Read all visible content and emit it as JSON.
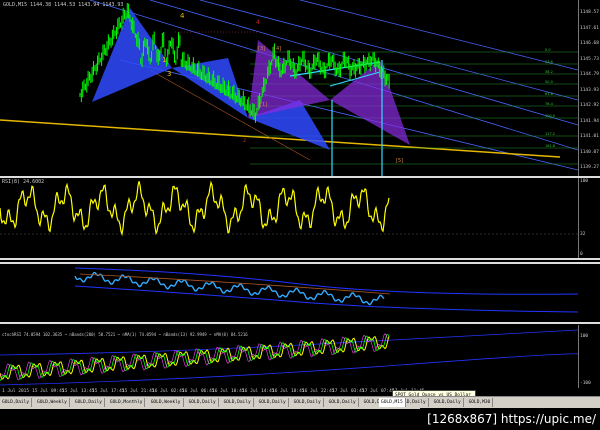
{
  "chart_header": "GOLD,M15  1144.38 1144.53 1143.94 1143.93",
  "price_axis": [
    "1148.57",
    "1147.61",
    "1146.68",
    "1145.73",
    "1144.79",
    "1143.93",
    "1142.92",
    "1141.94",
    "1141.01",
    "1140.07",
    "1139.27"
  ],
  "fib_levels": [
    "0.0",
    "23.6",
    "38.2",
    "50.0",
    "61.8",
    "76.4",
    "100.0",
    "127.2",
    "161.8"
  ],
  "wave_labels": {
    "w1": "1",
    "w2": "2",
    "w3": "3",
    "w4": "4",
    "w4red": "4",
    "w3_top": "[3]",
    "w4_top": "[4]",
    "w5": "[5]",
    "w1_bottom": "[1]",
    "r2": "2"
  },
  "rsi": {
    "label": "RSI(8) 24.6002",
    "top": "100",
    "mid": "32",
    "bottom": "0"
  },
  "stoch": {
    "label": "ctochRSI 74.0594 102.3635  ~ nBands(200) 50.7521  ~ nMA(1) 74.0594  ~ nBands(13) 92.9949  ~ nMA(8) 84.5216",
    "top": "100",
    "bottom": "-100"
  },
  "x_axis": [
    "1 Jul 2015",
    "15 Jul 09:45",
    "15 Jul 13:45",
    "15 Jul 17:45",
    "15 Jul 21:45",
    "16 Jul 02:45",
    "16 Jul 06:45",
    "16 Jul 10:45",
    "16 Jul 14:45",
    "16 Jul 18:45",
    "16 Jul 22:45",
    "17 Jul 03:45",
    "17 Jul 07:45",
    "17 Jul 11:45"
  ],
  "tabs": [
    "GOLD,Daily",
    "GOLD,Weekly",
    "GOLD,Daily",
    "GOLD,Monthly",
    "GOLD,Weekly",
    "GOLD,Daily",
    "GOLD,Daily",
    "GOLD,Daily",
    "GOLD,Daily",
    "GOLD,Daily",
    "GOLD,Daily",
    "GOLD,Daily",
    "GOLD,Daily",
    "GOLD,M30"
  ],
  "active_tab": "GOLD,M15",
  "tooltip": {
    "line1": "SPOT Gold Ounce vs US Dollar",
    "line2": "10374 bars, last price 1143.93000"
  },
  "stamp": "[1268x867] https://upic.me/",
  "colors": {
    "up": "#00ff00",
    "down": "#00ff00",
    "rsi": "#ffff00",
    "fib": "#33cc33",
    "harmonic_blue": "#3355ff",
    "harmonic_purple": "#8833cc",
    "channel": "#5577ff",
    "trend": "#e5b800",
    "cyan": "#33ddff"
  }
}
